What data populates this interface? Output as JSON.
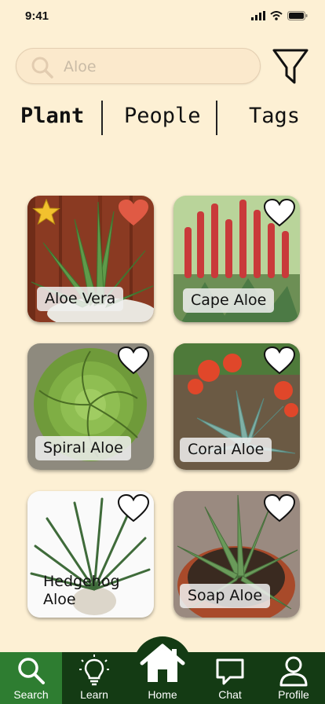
{
  "status_bar": {
    "time": "9:41"
  },
  "search": {
    "value": "",
    "placeholder": "Aloe"
  },
  "tabs": [
    {
      "label": "Plant",
      "active": true
    },
    {
      "label": "People",
      "active": false
    },
    {
      "label": "Tags",
      "active": false
    }
  ],
  "plants": [
    {
      "name": "Aloe Vera",
      "favorited": true,
      "starred": true
    },
    {
      "name": "Cape Aloe",
      "favorited": false,
      "starred": false
    },
    {
      "name": "Spiral Aloe",
      "favorited": false,
      "starred": false
    },
    {
      "name": "Coral Aloe",
      "favorited": false,
      "starred": false
    },
    {
      "name": "Hedgehog Aloe",
      "favorited": false,
      "starred": false
    },
    {
      "name": "Soap Aloe",
      "favorited": false,
      "starred": false
    }
  ],
  "nav": {
    "search": "Search",
    "learn": "Learn",
    "home": "Home",
    "chat": "Chat",
    "profile": "Profile",
    "active": "search"
  },
  "colors": {
    "background": "#fdf0d4",
    "nav_bg": "#143b14",
    "nav_active": "#2e7d31",
    "heart_filled": "#e05a44",
    "star": "#f2c12e"
  }
}
